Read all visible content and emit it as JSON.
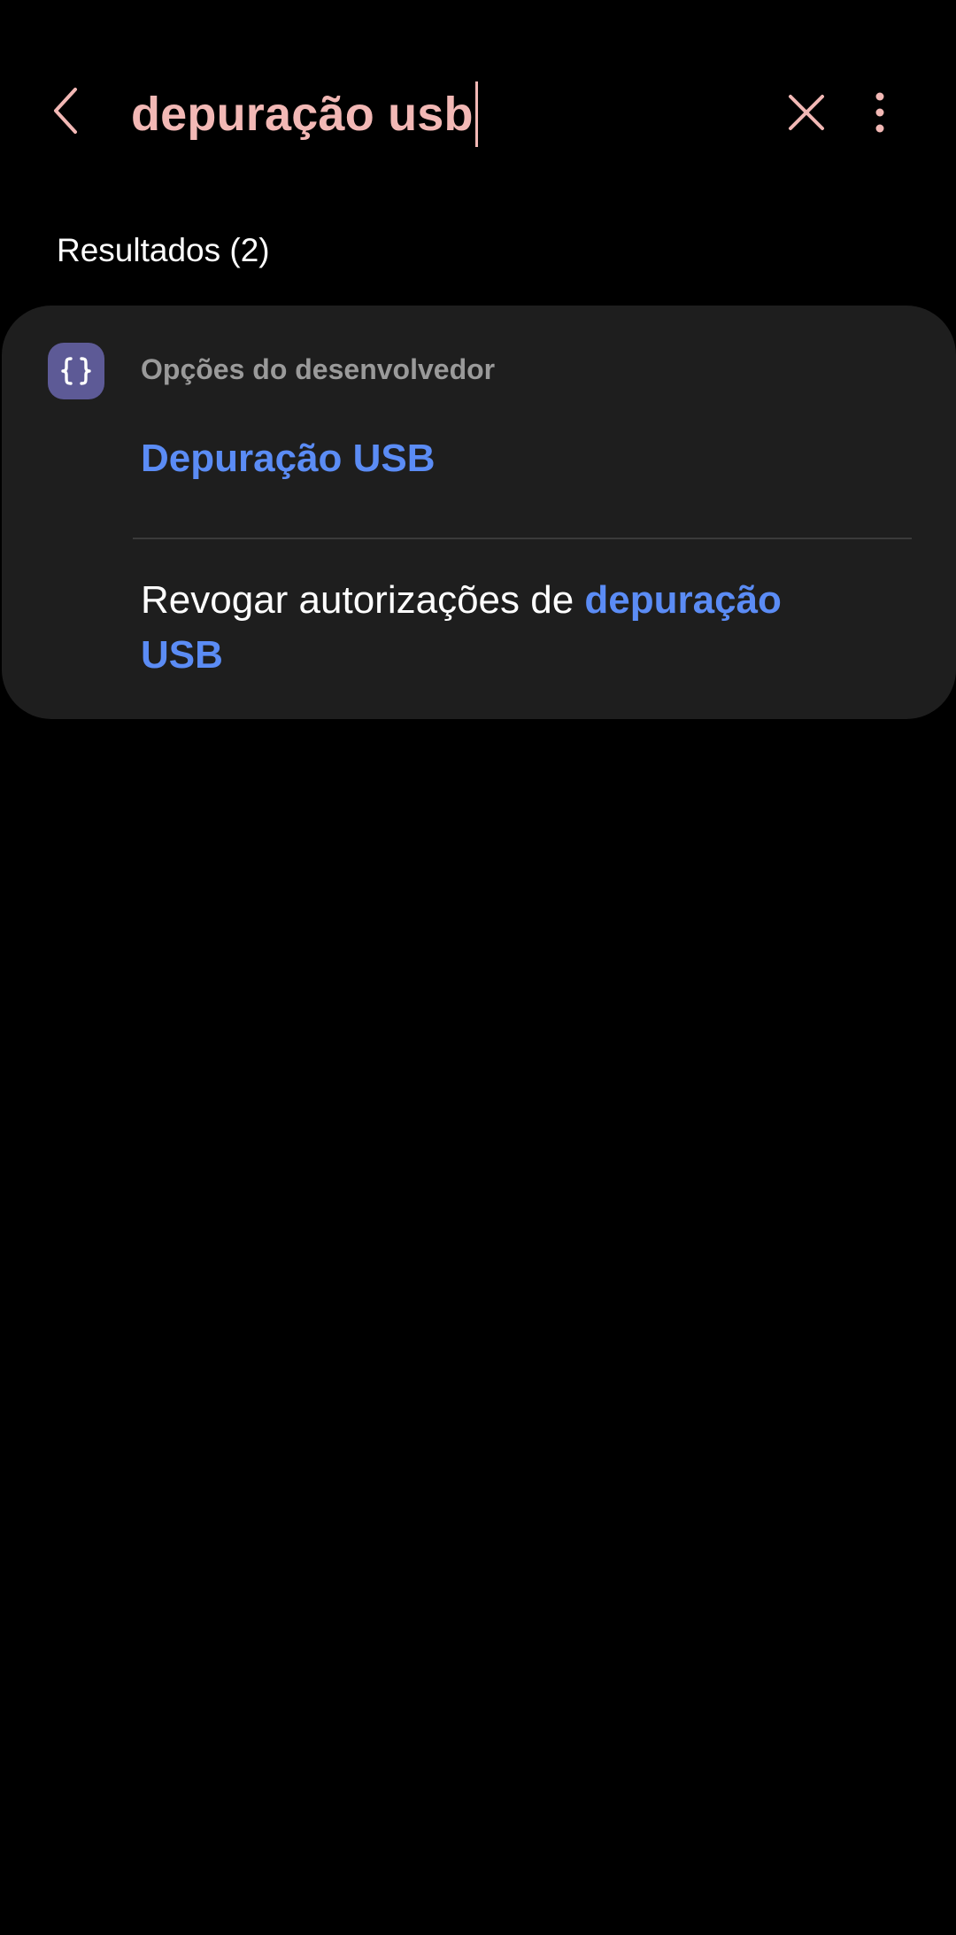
{
  "search": {
    "query": "depuração usb"
  },
  "results": {
    "header": "Resultados (2)",
    "category": "Opções do desenvolvedor",
    "items": [
      {
        "highlight": "Depuração USB"
      },
      {
        "prefix": "Revogar autorizações de ",
        "highlight_line1": "depuração",
        "highlight_line2": "USB"
      }
    ]
  },
  "colors": {
    "accent": "#5b8cf5",
    "search_text": "#f2b8b5",
    "icon_bg": "#5d5a96",
    "card_bg": "#1e1e1e"
  },
  "icons": {
    "back": "back-chevron-icon",
    "clear": "close-icon",
    "more": "more-vert-icon",
    "category": "developer-braces-icon"
  }
}
